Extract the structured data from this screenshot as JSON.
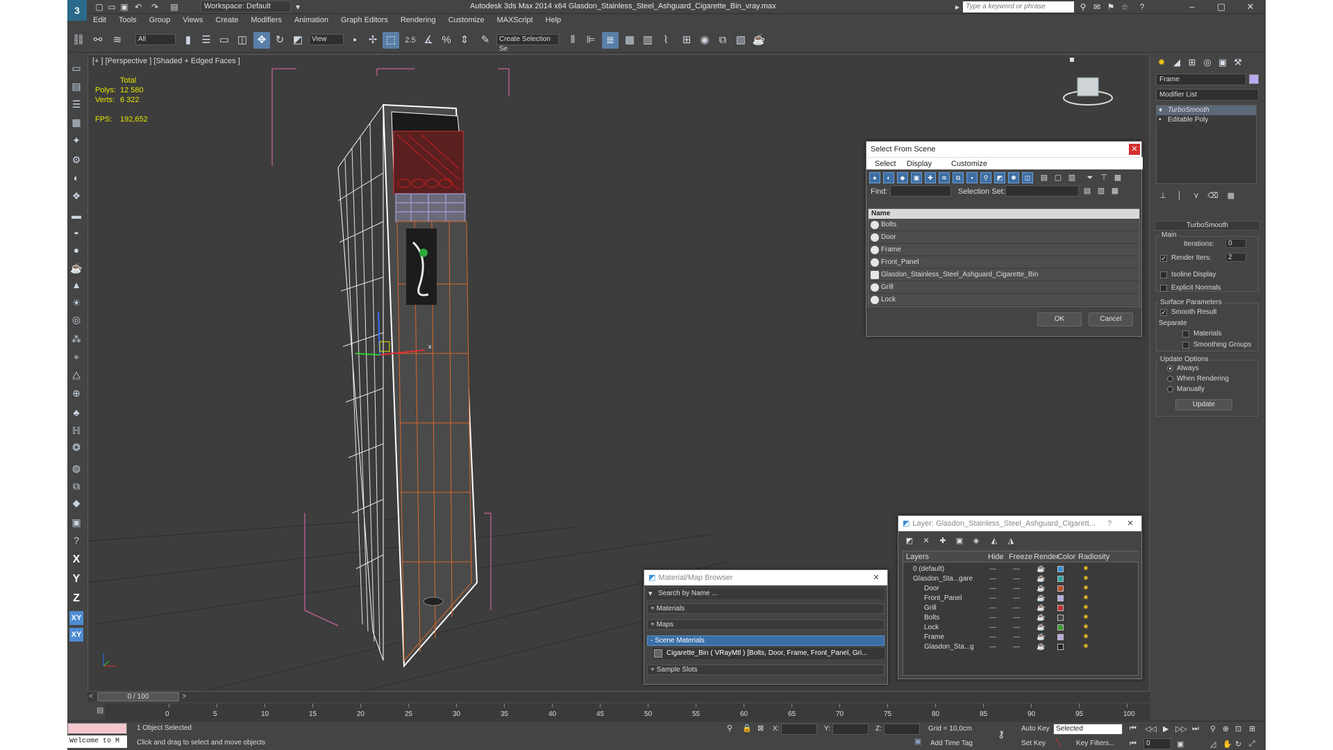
{
  "titlebar": {
    "workspace": "Workspace: Default",
    "title": "Autodesk 3ds Max  2014 x64      Glasdon_Stainless_Steel_Ashguard_Cigarette_Bin_vray.max",
    "search_placeholder": "Type a keyword or phrase"
  },
  "menu": [
    "Edit",
    "Tools",
    "Group",
    "Views",
    "Create",
    "Modifiers",
    "Animation",
    "Graph Editors",
    "Rendering",
    "Customize",
    "MAXScript",
    "Help"
  ],
  "toolbar": {
    "selection_filter": "All",
    "reference_coord": "View",
    "named_selection": "Create Selection Se",
    "snap_label": "2.5"
  },
  "viewport": {
    "label": "[+ ] [Perspective ] [Shaded + Edged Faces ]",
    "stats": {
      "header": "Total",
      "polys_label": "Polys:",
      "polys_value": "12 580",
      "verts_label": "Verts:",
      "verts_value": "6 322",
      "fps_label": "FPS:",
      "fps_value": "192,652"
    },
    "gizmo_x": "x"
  },
  "command_panel": {
    "object_name": "Frame",
    "modifier_list": "Modifier List",
    "stack": [
      "TurboSmooth",
      "Editable Poly"
    ],
    "turbosmooth": {
      "title": "TurboSmooth",
      "main": "Main",
      "iterations_label": "Iterations:",
      "iterations": "0",
      "render_iters_label": "Render Iters:",
      "render_iters": "2",
      "isoline": "Isoline Display",
      "explicit_normals": "Explicit Normals",
      "surface_params": "Surface Parameters",
      "smooth_result": "Smooth Result",
      "separate": "Separate",
      "materials": "Materials",
      "smoothing_groups": "Smoothing Groups",
      "update_options": "Update Options",
      "always": "Always",
      "when_rendering": "When Rendering",
      "manually": "Manually",
      "update_button": "Update"
    }
  },
  "select_from_scene": {
    "title": "Select From Scene",
    "menus": [
      "Select",
      "Display",
      "Customize"
    ],
    "find_label": "Find:",
    "selection_set_label": "Selection Set:",
    "column_name": "Name",
    "items": [
      "Bolts",
      "Door",
      "Frame",
      "Front_Panel",
      "Glasdon_Stainless_Steel_Ashguard_Cigarette_Bin",
      "Grill",
      "Lock"
    ],
    "ok": "OK",
    "cancel": "Cancel"
  },
  "layer_dialog": {
    "title": "Layer: Glasdon_Stainless_Steel_Ashguard_Cigarett...",
    "help": "?",
    "columns": [
      "Layers",
      "Hide",
      "Freeze",
      "Render",
      "Color",
      "Radiosity"
    ],
    "rows": [
      {
        "name": "0 (default)",
        "color": "#3a8fd6"
      },
      {
        "name": "Glasdon_Sta...gare",
        "color": "#2ea6a0"
      },
      {
        "name": "Door",
        "color": "#c0502a"
      },
      {
        "name": "Front_Panel",
        "color": "#b7a6e0"
      },
      {
        "name": "Grill",
        "color": "#c93030"
      },
      {
        "name": "Bolts",
        "color": "#444444"
      },
      {
        "name": "Lock",
        "color": "#3c9b35"
      },
      {
        "name": "Frame",
        "color": "#b7a6e0"
      },
      {
        "name": "Glasdon_Sta...g",
        "color": "#222222"
      }
    ]
  },
  "material_browser": {
    "title": "Material/Map Browser",
    "search": "Search by Name ...",
    "sections": [
      "+ Materials",
      "+ Maps",
      "- Scene Materials",
      "+ Sample Slots"
    ],
    "material_entry": "Cigarette_Bin  ( VRayMtl )  [Bolts, Door, Frame, Front_Panel, Gri..."
  },
  "timeline": {
    "frame": "0 / 100",
    "ticks": [
      "0",
      "5",
      "10",
      "15",
      "20",
      "25",
      "30",
      "35",
      "40",
      "45",
      "50",
      "55",
      "60",
      "65",
      "70",
      "75",
      "80",
      "85",
      "90",
      "95",
      "100"
    ]
  },
  "status": {
    "maxscript": "Welcome to M",
    "selected": "1 Object Selected",
    "prompt": "Click and drag to select and move objects",
    "x_label": "X:",
    "y_label": "Y:",
    "z_label": "Z:",
    "grid": "Grid = 10,0cm",
    "add_time_tag": "Add Time Tag",
    "auto_key": "Auto Key",
    "set_key": "Set Key",
    "selected_dropdown": "Selected",
    "key_filters": "Key Filters...",
    "frame_field": "0"
  },
  "axes": [
    "X",
    "Y",
    "Z",
    "XY",
    "XY"
  ]
}
